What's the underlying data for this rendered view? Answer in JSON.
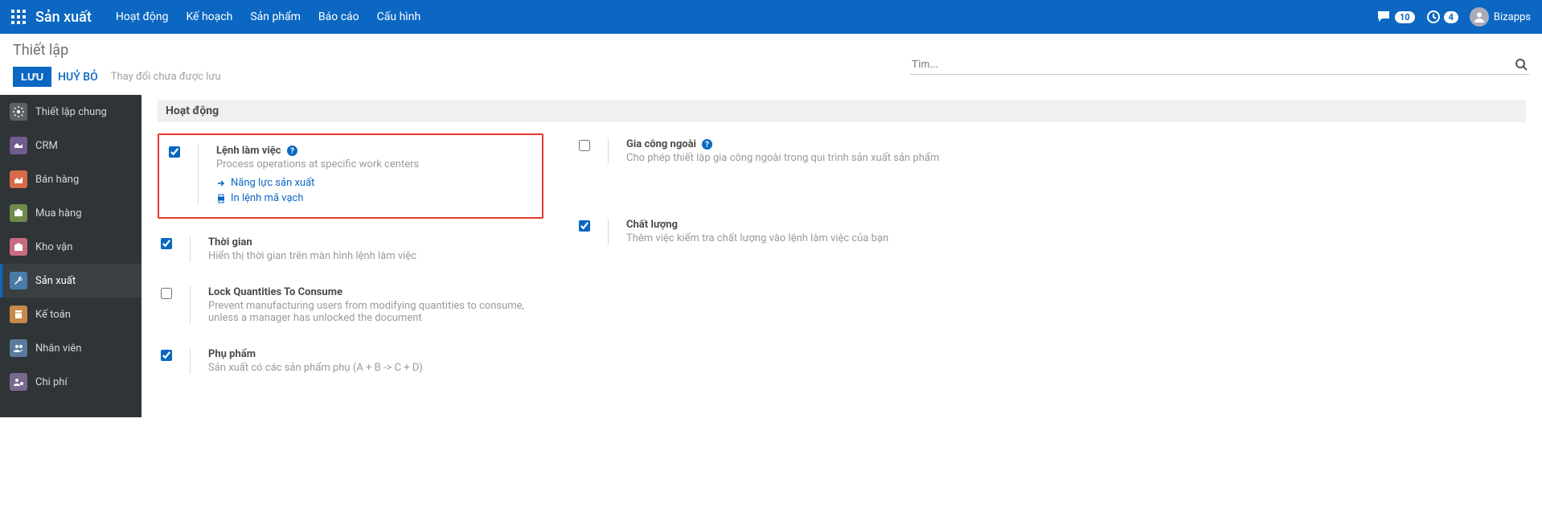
{
  "topbar": {
    "brand": "Sản xuất",
    "menu": [
      "Hoạt động",
      "Kế hoạch",
      "Sản phẩm",
      "Báo cáo",
      "Cấu hình"
    ],
    "messages_count": "10",
    "activities_count": "4",
    "user": "Bizapps"
  },
  "control": {
    "breadcrumb": "Thiết lập",
    "save": "LƯU",
    "discard": "HUỶ BỎ",
    "status": "Thay đổi chưa được lưu",
    "search_placeholder": "Tìm..."
  },
  "sidebar": {
    "items": [
      {
        "label": "Thiết lập chung"
      },
      {
        "label": "CRM"
      },
      {
        "label": "Bán hàng"
      },
      {
        "label": "Mua hàng"
      },
      {
        "label": "Kho vận"
      },
      {
        "label": "Sản xuất"
      },
      {
        "label": "Kế toán"
      },
      {
        "label": "Nhân viên"
      },
      {
        "label": "Chi phí"
      }
    ]
  },
  "section": {
    "title": "Hoạt động"
  },
  "settings": {
    "work_orders": {
      "title": "Lệnh làm việc",
      "desc": "Process operations at specific work centers",
      "link1": "Năng lực sản xuất",
      "link2": "In lệnh mã vạch",
      "checked": true
    },
    "subcontracting": {
      "title": "Gia công ngoài",
      "desc": "Cho phép thiết lập gia công ngoài trong qui trình sản xuất sản phẩm",
      "checked": false
    },
    "time": {
      "title": "Thời gian",
      "desc": "Hiển thị thời gian trên màn hình lệnh làm việc",
      "checked": true
    },
    "quality": {
      "title": "Chất lượng",
      "desc": "Thêm việc kiểm tra chất lượng vào lệnh làm việc của bạn",
      "checked": true
    },
    "lock": {
      "title": "Lock Quantities To Consume",
      "desc": "Prevent manufacturing users from modifying quantities to consume, unless a manager has unlocked the document",
      "checked": false
    },
    "byproducts": {
      "title": "Phụ phẩm",
      "desc": "Sản xuất có các sản phẩm phụ (A + B -> C + D)",
      "checked": true
    }
  }
}
